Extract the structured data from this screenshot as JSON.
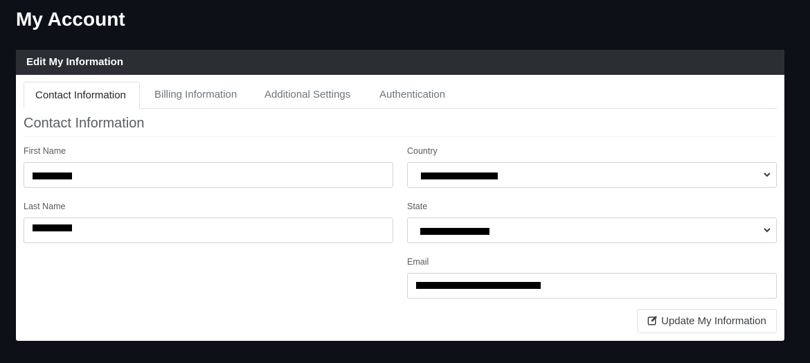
{
  "page": {
    "title": "My Account"
  },
  "card": {
    "header": "Edit My Information"
  },
  "tabs": [
    {
      "label": "Contact Information",
      "active": true
    },
    {
      "label": "Billing Information",
      "active": false
    },
    {
      "label": "Additional Settings",
      "active": false
    },
    {
      "label": "Authentication",
      "active": false
    }
  ],
  "section": {
    "title": "Contact Information"
  },
  "form": {
    "first_name": {
      "label": "First Name",
      "value": ""
    },
    "last_name": {
      "label": "Last Name",
      "value": ""
    },
    "country": {
      "label": "Country",
      "value": ""
    },
    "state": {
      "label": "State",
      "value": ""
    },
    "email": {
      "label": "Email",
      "value": ""
    }
  },
  "actions": {
    "update_label": "Update My Information"
  },
  "icons": {
    "update": "edit-icon",
    "select": "chevron-down-icon"
  }
}
